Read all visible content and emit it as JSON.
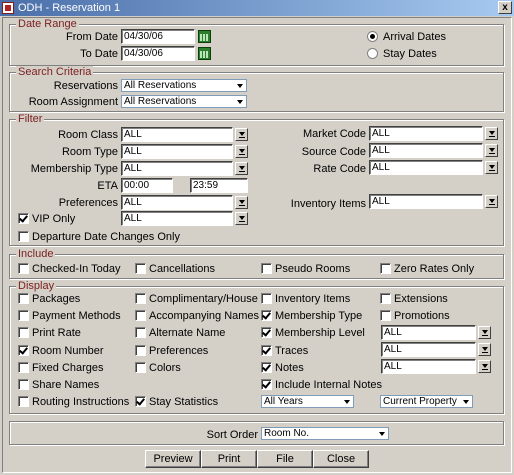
{
  "window": {
    "title": "ODH - Reservation 1",
    "close_label": "x"
  },
  "date_range": {
    "legend": "Date Range",
    "from_label": "From Date",
    "from_value": "04/30/06",
    "to_label": "To Date",
    "to_value": "04/30/06",
    "arrival_label": "Arrival Dates",
    "stay_label": "Stay Dates",
    "selected": "arrival"
  },
  "search_criteria": {
    "legend": "Search Criteria",
    "reservations_label": "Reservations",
    "reservations_value": "All Reservations",
    "room_assignment_label": "Room Assignment",
    "room_assignment_value": "All Reservations"
  },
  "filter": {
    "legend": "Filter",
    "room_class_label": "Room Class",
    "room_class_value": "ALL",
    "room_type_label": "Room Type",
    "room_type_value": "ALL",
    "membership_type_label": "Membership Type",
    "membership_type_value": "ALL",
    "eta_label": "ETA",
    "eta_from": "00:00",
    "eta_to": "23:59",
    "preferences_label": "Preferences",
    "preferences_value": "ALL",
    "vip_label": "VIP Only",
    "vip_value": "ALL",
    "departure_label": "Departure Date Changes Only",
    "market_code_label": "Market Code",
    "market_code_value": "ALL",
    "source_code_label": "Source Code",
    "source_code_value": "ALL",
    "rate_code_label": "Rate Code",
    "rate_code_value": "ALL",
    "inventory_label": "Inventory Items",
    "inventory_value": "ALL"
  },
  "include": {
    "legend": "Include",
    "checked_in": "Checked-In Today",
    "cancellations": "Cancellations",
    "pseudo_rooms": "Pseudo Rooms",
    "zero_rates": "Zero Rates Only"
  },
  "display": {
    "legend": "Display",
    "col1": [
      "Packages",
      "Payment Methods",
      "Print Rate",
      "Room Number",
      "Fixed Charges",
      "Share Names",
      "Routing Instructions"
    ],
    "col2": [
      "Complimentary/House",
      "Accompanying Names",
      "Alternate Name",
      "Preferences",
      "Colors",
      "Stay Statistics"
    ],
    "col3": [
      "Inventory Items",
      "Membership Type",
      "Membership Level",
      "Traces",
      "Notes",
      "Include Internal Notes"
    ],
    "col4": [
      "Extensions",
      "Promotions"
    ],
    "membership_level_value": "ALL",
    "traces_value": "ALL",
    "notes_value": "ALL",
    "years_value": "All Years",
    "property_value": "Current Property"
  },
  "sort": {
    "label": "Sort Order",
    "value": "Room No."
  },
  "buttons": {
    "preview": "Preview",
    "print": "Print",
    "file": "File",
    "close": "Close"
  }
}
